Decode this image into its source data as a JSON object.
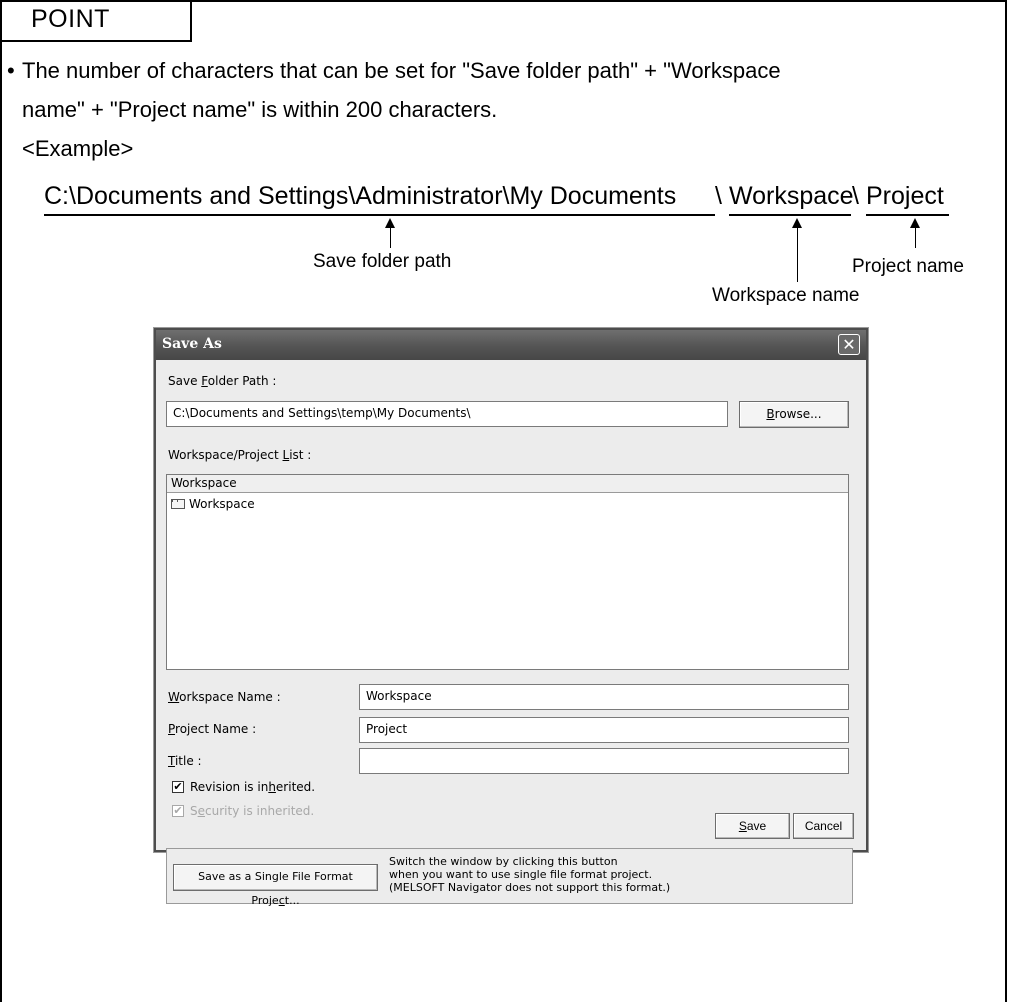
{
  "point": {
    "label": "POINT"
  },
  "note": {
    "bullet": "•",
    "line1": "The number of characters that can be set for \"Save folder path\" + \"Workspace",
    "line2": "name\" + \"Project name\" is within 200 characters.",
    "example_label": "<Example>"
  },
  "example_path": {
    "folder": "C:\\Documents and Settings\\Administrator\\My Documents",
    "sep1": "\\",
    "workspace": "Workspace",
    "sep2": "\\",
    "project": "Project"
  },
  "callouts": {
    "save_folder_path": "Save folder path",
    "project_name": "Project name",
    "workspace_name": "Workspace name"
  },
  "dialog": {
    "title": "Save As",
    "close_glyph": "✕",
    "save_folder_label_pre": "Save ",
    "save_folder_label_key": "F",
    "save_folder_label_post": "older Path :",
    "save_folder_value": "C:\\Documents and Settings\\temp\\My Documents\\",
    "browse_key": "B",
    "browse_rest": "rowse...",
    "list_label_pre": "Workspace/Project ",
    "list_label_key": "L",
    "list_label_post": "ist :",
    "list_header": "Workspace",
    "list_items": [
      "Workspace"
    ],
    "workspace_name_key": "W",
    "workspace_name_rest": "orkspace Name :",
    "workspace_name_value": "Workspace",
    "project_name_key": "P",
    "project_name_rest": "roject Name :",
    "project_name_value": "Project",
    "title_key": "T",
    "title_rest": "itle :",
    "title_value": "",
    "revision_pre": "Revision is in",
    "revision_key": "h",
    "revision_post": "erited.",
    "revision_checked": true,
    "security_pre": "S",
    "security_key": "e",
    "security_post": "curity is inherited.",
    "security_checked": true,
    "check_glyph": "✔",
    "save_key": "S",
    "save_rest": "ave",
    "cancel": "Cancel",
    "single_file_pre": "Save as a Single File Format Proje",
    "single_file_key": "c",
    "single_file_post": "t...",
    "switch_info": "Switch the window by clicking this button\nwhen you want to use single file format project.\n(MELSOFT Navigator does not support this format.)"
  }
}
